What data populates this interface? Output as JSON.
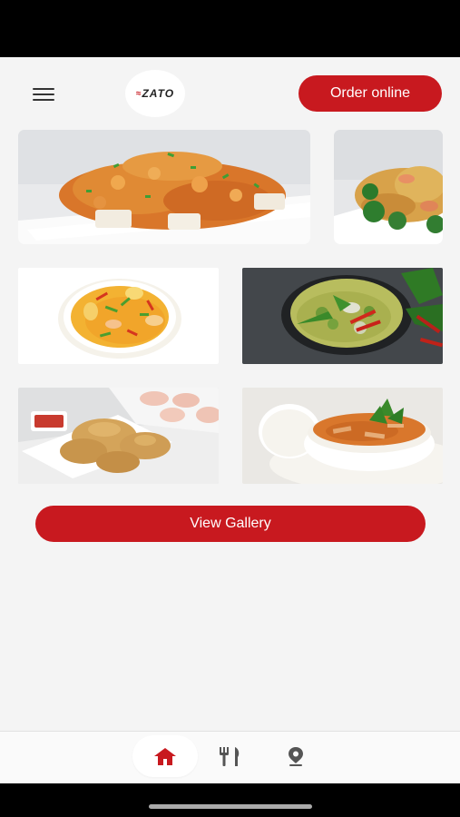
{
  "header": {
    "logo_text": "ZATO",
    "order_label": "Order online"
  },
  "gallery": {
    "photos": [
      {
        "name": "fried-shrimp-dish"
      },
      {
        "name": "stir-fry-noodles-dish"
      },
      {
        "name": "yellow-curry-shrimp-dish"
      },
      {
        "name": "green-curry-dish"
      },
      {
        "name": "fried-wontons-dish"
      },
      {
        "name": "red-curry-rice-dish"
      }
    ],
    "view_label": "View Gallery"
  },
  "tabbar": {
    "tabs": [
      {
        "name": "home",
        "icon": "home-icon",
        "active": true
      },
      {
        "name": "menu",
        "icon": "fork-knife-icon",
        "active": false
      },
      {
        "name": "location",
        "icon": "location-pin-icon",
        "active": false
      }
    ]
  },
  "colors": {
    "accent": "#c8191f",
    "background": "#f4f4f4",
    "icon_inactive": "#555555"
  }
}
